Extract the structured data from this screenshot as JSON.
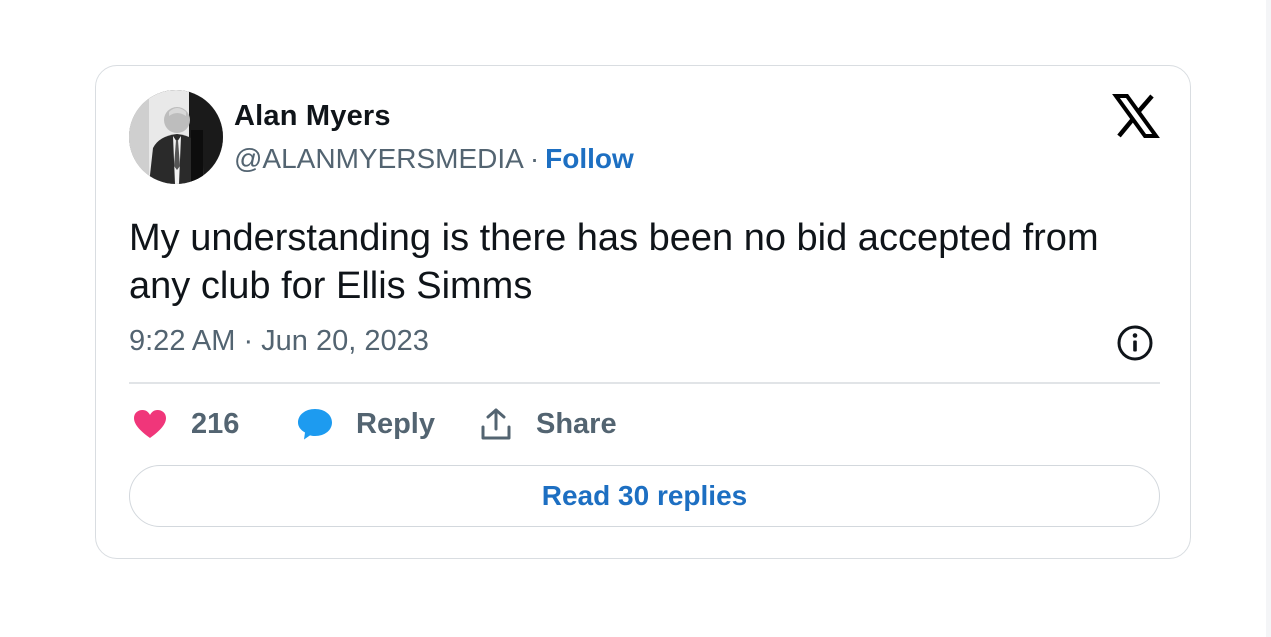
{
  "author": {
    "name": "Alan Myers",
    "handle": "@ALANMYERSMEDIA",
    "separator": "·",
    "follow_label": "Follow",
    "avatar_icon": "profile-photo"
  },
  "brand": {
    "logo_icon": "x-logo-icon"
  },
  "tweet": {
    "text": "My understanding is there has been no bid accepted from any club for Ellis Simms",
    "timestamp": "9:22 AM · Jun 20, 2023"
  },
  "actions": {
    "like_count": "216",
    "reply_label": "Reply",
    "share_label": "Share"
  },
  "replies_button": {
    "label": "Read 30 replies"
  },
  "colors": {
    "heart": "#f0367a",
    "reply_bubble": "#1d9bf0",
    "link": "#1d6fc2",
    "muted": "#536471",
    "text": "#0f1419"
  }
}
